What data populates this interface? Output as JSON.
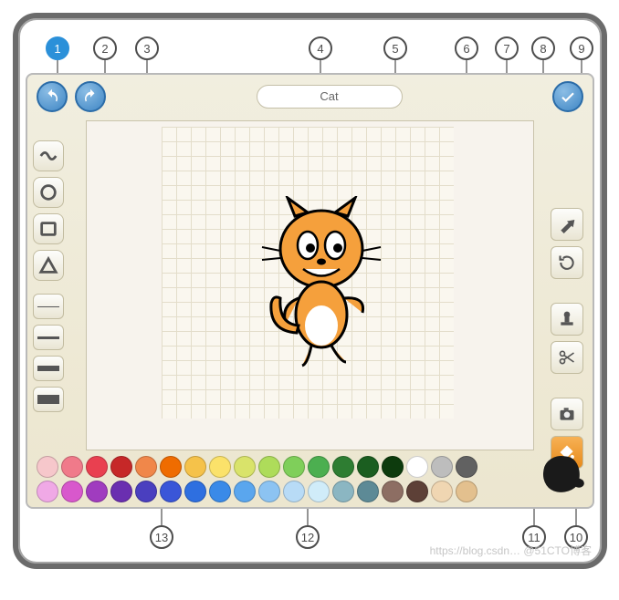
{
  "callouts": [
    "1",
    "2",
    "3",
    "4",
    "5",
    "6",
    "7",
    "8",
    "9",
    "10",
    "11",
    "12",
    "13"
  ],
  "sprite_name": "Cat",
  "left_tools": [
    {
      "name": "brush",
      "icon": "squiggle"
    },
    {
      "name": "circle",
      "icon": "circle"
    },
    {
      "name": "rect",
      "icon": "rect"
    },
    {
      "name": "triangle",
      "icon": "triangle"
    }
  ],
  "line_widths": [
    1,
    3,
    6,
    10
  ],
  "selected_width_index": 1,
  "right_tools": [
    {
      "name": "drag",
      "icon": "arrow"
    },
    {
      "name": "rotate",
      "icon": "rotate"
    },
    {
      "name": "stamp",
      "icon": "stamp"
    },
    {
      "name": "scissors",
      "icon": "scissors"
    },
    {
      "name": "camera",
      "icon": "camera"
    },
    {
      "name": "fill",
      "icon": "bucket",
      "highlight": true
    }
  ],
  "palette_row1": [
    "#f6c7cb",
    "#f07a8a",
    "#e94050",
    "#c62828",
    "#f0874a",
    "#ef6c00",
    "#f5c24a",
    "#fbe26a",
    "#d9e36a",
    "#aedc5a",
    "#7fcf5a",
    "#4caf50",
    "#2e7d32",
    "#1b5e20",
    "#0d3b0d",
    "#ffffff",
    "#bdbdbd",
    "#616161"
  ],
  "palette_row2": [
    "#f0a9e6",
    "#d858cc",
    "#a03cbf",
    "#6a2fb0",
    "#4a3fbf",
    "#3a56d8",
    "#2e6fe0",
    "#3a8ae8",
    "#5aa6ee",
    "#8cc3f2",
    "#b8dbf6",
    "#d0ecf9",
    "#8bb6c2",
    "#5d8a96",
    "#8d6e63",
    "#5d4037",
    "#f0d6b2",
    "#e3c08e"
  ],
  "watermark": "https://blog.csdn…  @51CTO博客"
}
